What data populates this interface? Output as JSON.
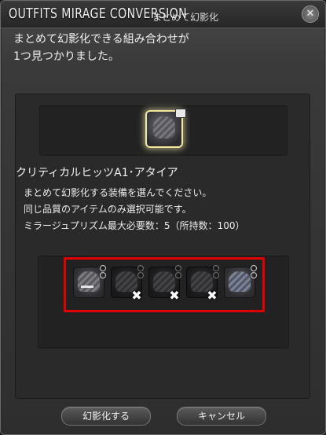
{
  "window": {
    "title": "OUTFITS MIRAGE CONVERSION",
    "subtitle": "まとめて幻影化"
  },
  "message": {
    "lines": [
      "まとめて幻影化できる組み合わせが",
      "1つ見つかりました。"
    ]
  },
  "main_item": {
    "icon": "hat-icon",
    "name": "クリティカルヒッツA1･アタイア"
  },
  "instructions": {
    "lines": [
      "まとめて幻影化する装備を選んでください。",
      "同じ品質のアイテムのみ選択可能です。",
      "ミラージュプリズム最大必要数：5（所持数：100）"
    ]
  },
  "slots": [
    {
      "icon": "hat-icon",
      "selected": true,
      "marked_x": false
    },
    {
      "icon": "hat-icon",
      "selected": false,
      "marked_x": true
    },
    {
      "icon": "hat-icon",
      "selected": false,
      "marked_x": true
    },
    {
      "icon": "hat-icon",
      "selected": false,
      "marked_x": true
    },
    {
      "icon": "hat-icon",
      "selected": true,
      "marked_x": false
    }
  ],
  "slot_marks": {
    "x": "✖"
  },
  "buttons": {
    "confirm": "幻影化する",
    "cancel": "キャンセル",
    "close_glyph": "✕"
  },
  "colors": {
    "highlight_frame": "#e00000",
    "selected_glow": "#f3e7a0"
  }
}
